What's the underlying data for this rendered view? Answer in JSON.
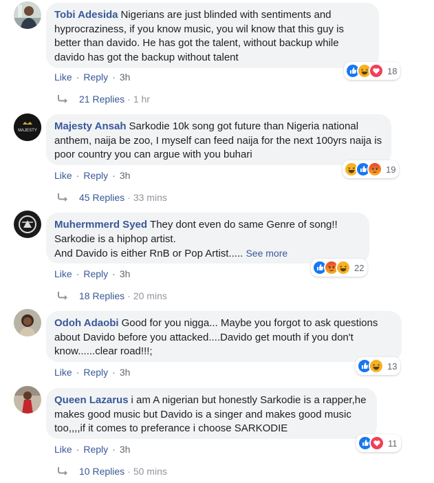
{
  "comments": [
    {
      "author": "Tobi Adesida",
      "text": "Nigerians are just blinded with sentiments and hyprocraziness, if you know music, you wil know that this guy is better than davido. He has got the talent, without backup while davido has got the backup without talent",
      "like": "Like",
      "reply": "Reply",
      "time": "3h",
      "reaction_count": "18",
      "reactions": [
        "like-icon",
        "haha-icon",
        "love-icon"
      ],
      "replies": "21 Replies",
      "replies_time": "1 hr"
    },
    {
      "author": "Majesty Ansah",
      "text": "Sarkodie 10k song got future than Nigeria national anthem, naija be zoo, I myself can feed naija for the next 100yrs naija is poor country you can argue with you buhari",
      "like": "Like",
      "reply": "Reply",
      "time": "3h",
      "reaction_count": "19",
      "reactions": [
        "haha-icon",
        "like-icon",
        "angry-icon"
      ],
      "replies": "45 Replies",
      "replies_time": "33 mins",
      "avatar_text": "MAJESTY"
    },
    {
      "author": "Muhermmerd Syed",
      "text_line1": "They dont even do same Genre of song!! Sarkodie is a hiphop artist.",
      "text_line2": "And Davido is either RnB or Pop Artist.....",
      "see_more": "See more",
      "like": "Like",
      "reply": "Reply",
      "time": "3h",
      "reaction_count": "22",
      "reactions": [
        "like-icon",
        "angry-icon",
        "haha-icon"
      ],
      "replies": "18 Replies",
      "replies_time": "20 mins"
    },
    {
      "author": "Odoh Adaobi",
      "text": "Good for you nigga... Maybe you forgot to ask questions about Davido before you attacked....Davido get mouth if you don't know......clear road!!!;",
      "like": "Like",
      "reply": "Reply",
      "time": "3h",
      "reaction_count": "13",
      "reactions": [
        "like-icon",
        "haha-icon"
      ]
    },
    {
      "author": "Queen Lazarus",
      "text": "i am A nigerian but honestly Sarkodie is a rapper,he makes good music but Davido is a singer and makes good music too,,,,if it comes to preferance i choose SARKODIE",
      "like": "Like",
      "reply": "Reply",
      "time": "3h",
      "reaction_count": "11",
      "reactions": [
        "like-icon",
        "love-icon"
      ],
      "replies": "10 Replies",
      "replies_time": "50 mins"
    }
  ],
  "separator": "·",
  "colors": {
    "link": "#385898",
    "like": "#1877f2",
    "love": "#f33e58",
    "haha": "#f7b125",
    "angry": "#e9710f"
  }
}
